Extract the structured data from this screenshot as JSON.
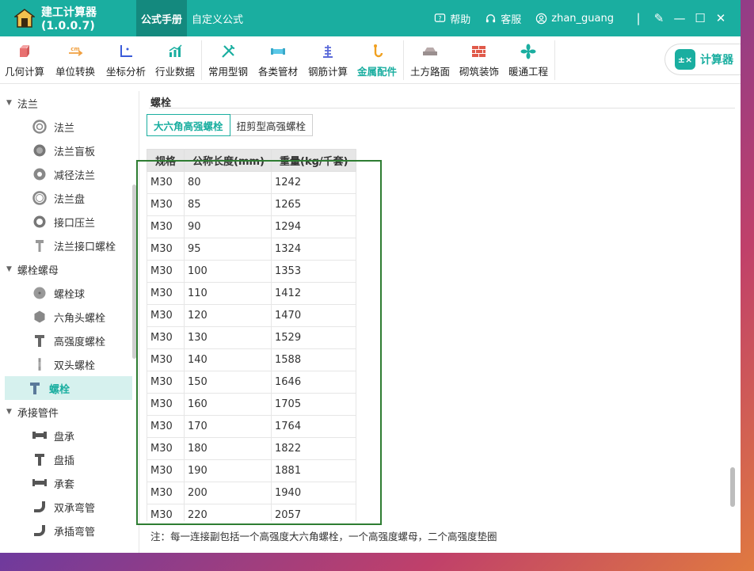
{
  "titlebar": {
    "app_title": "建工计算器(1.0.0.7)",
    "tabs": [
      {
        "label": "公式手册",
        "active": true
      },
      {
        "label": "自定义公式",
        "active": false
      }
    ],
    "help": "帮助",
    "service": "客服",
    "user": "zhan_guang",
    "accent": "#1aaea0"
  },
  "toolbar": {
    "tools": [
      {
        "label": "几何计算",
        "icon": "cube-icon"
      },
      {
        "label": "单位转换",
        "icon": "unit-convert-icon"
      },
      {
        "label": "坐标分析",
        "icon": "axis-icon"
      },
      {
        "label": "行业数据",
        "icon": "bar-chart-icon"
      },
      {
        "label": "常用型钢",
        "icon": "wrench-icon"
      },
      {
        "label": "各类管材",
        "icon": "pipe-icon"
      },
      {
        "label": "钢筋计算",
        "icon": "rebar-icon"
      },
      {
        "label": "金属配件",
        "icon": "hook-icon",
        "active": true
      },
      {
        "label": "土方路面",
        "icon": "road-icon"
      },
      {
        "label": "砌筑装饰",
        "icon": "brick-icon"
      },
      {
        "label": "暖通工程",
        "icon": "fan-icon"
      }
    ],
    "calculator_label": "计算器"
  },
  "sidebar": {
    "groups": [
      {
        "label": "法兰",
        "items": [
          {
            "label": "法兰",
            "icon": "flange-icon"
          },
          {
            "label": "法兰盲板",
            "icon": "blind-flange-icon"
          },
          {
            "label": "减径法兰",
            "icon": "reducing-flange-icon"
          },
          {
            "label": "法兰盘",
            "icon": "flange-plate-icon"
          },
          {
            "label": "接口压兰",
            "icon": "gland-icon"
          },
          {
            "label": "法兰接口螺栓",
            "icon": "bolt-icon"
          }
        ]
      },
      {
        "label": "螺栓螺母",
        "items": [
          {
            "label": "螺栓球",
            "icon": "bolt-ball-icon"
          },
          {
            "label": "六角头螺栓",
            "icon": "hex-bolt-icon"
          },
          {
            "label": "高强度螺栓",
            "icon": "hs-bolt-icon"
          },
          {
            "label": "双头螺栓",
            "icon": "stud-bolt-icon"
          },
          {
            "label": "螺栓",
            "icon": "bolt-icon",
            "active": true
          }
        ]
      },
      {
        "label": "承接管件",
        "items": [
          {
            "label": "盘承",
            "icon": "pipe-fitting-icon"
          },
          {
            "label": "盘插",
            "icon": "pipe-fitting-icon"
          },
          {
            "label": "承套",
            "icon": "pipe-fitting-icon"
          },
          {
            "label": "双承弯管",
            "icon": "elbow-icon"
          },
          {
            "label": "承插弯管",
            "icon": "elbow-icon"
          }
        ]
      }
    ]
  },
  "main": {
    "section_title": "螺栓",
    "tabs": [
      {
        "label": "大六角高强螺栓",
        "active": true
      },
      {
        "label": "扭剪型高强螺栓",
        "active": false
      }
    ],
    "table": {
      "headers": [
        "规格",
        "公称长度(mm)",
        "重量(kg/千套)"
      ],
      "rows": [
        [
          "M30",
          "80",
          "1242"
        ],
        [
          "M30",
          "85",
          "1265"
        ],
        [
          "M30",
          "90",
          "1294"
        ],
        [
          "M30",
          "95",
          "1324"
        ],
        [
          "M30",
          "100",
          "1353"
        ],
        [
          "M30",
          "110",
          "1412"
        ],
        [
          "M30",
          "120",
          "1470"
        ],
        [
          "M30",
          "130",
          "1529"
        ],
        [
          "M30",
          "140",
          "1588"
        ],
        [
          "M30",
          "150",
          "1646"
        ],
        [
          "M30",
          "160",
          "1705"
        ],
        [
          "M30",
          "170",
          "1764"
        ],
        [
          "M30",
          "180",
          "1822"
        ],
        [
          "M30",
          "190",
          "1881"
        ],
        [
          "M30",
          "200",
          "1940"
        ],
        [
          "M30",
          "220",
          "2057"
        ]
      ]
    },
    "note": "注：每一连接副包括一个高强度大六角螺栓，一个高强度螺母，二个高强度垫圈"
  }
}
